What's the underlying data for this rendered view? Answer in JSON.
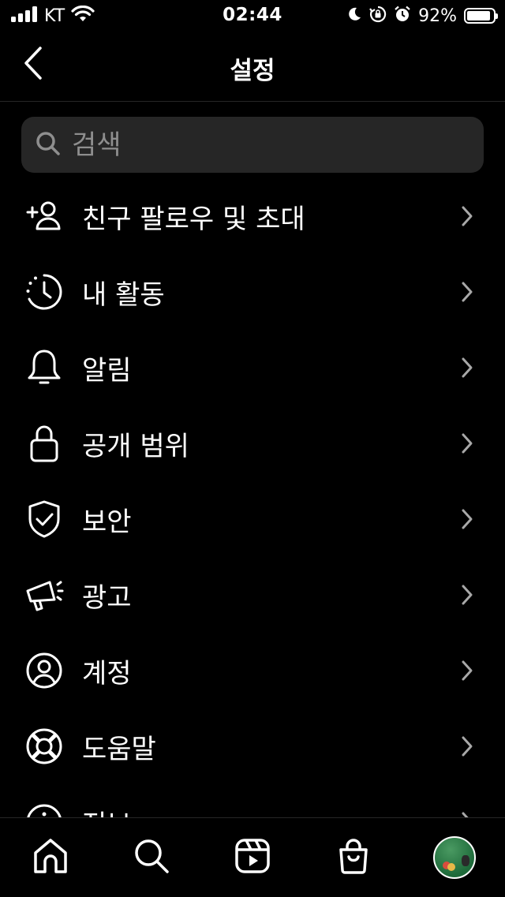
{
  "status_bar": {
    "carrier": "KT",
    "time": "02:44",
    "battery_percent": "92%",
    "battery_level": 0.92,
    "icons": [
      "signal-icon",
      "wifi-icon",
      "moon-icon",
      "orientation-lock-icon",
      "alarm-icon",
      "battery-icon"
    ]
  },
  "header": {
    "title": "설정",
    "back_icon": "chevron-left-icon"
  },
  "search": {
    "placeholder": "검색",
    "value": "",
    "icon": "search-icon"
  },
  "menu": {
    "items": [
      {
        "label": "친구 팔로우 및 초대",
        "icon": "add-person-icon"
      },
      {
        "label": "내 활동",
        "icon": "activity-clock-icon"
      },
      {
        "label": "알림",
        "icon": "bell-icon"
      },
      {
        "label": "공개 범위",
        "icon": "lock-icon"
      },
      {
        "label": "보안",
        "icon": "shield-check-icon"
      },
      {
        "label": "광고",
        "icon": "megaphone-icon"
      },
      {
        "label": "계정",
        "icon": "account-circle-icon"
      },
      {
        "label": "도움말",
        "icon": "lifebuoy-icon"
      },
      {
        "label": "정보",
        "icon": "info-icon"
      }
    ]
  },
  "tabbar": {
    "tabs": [
      "home-icon",
      "search-icon",
      "reels-icon",
      "shop-icon",
      "profile-avatar"
    ]
  },
  "colors": {
    "background": "#000000",
    "text": "#ffffff",
    "search_bg": "#262626",
    "placeholder": "#8e8e8e",
    "chevron": "#a8a8a8",
    "divider": "#262626"
  }
}
